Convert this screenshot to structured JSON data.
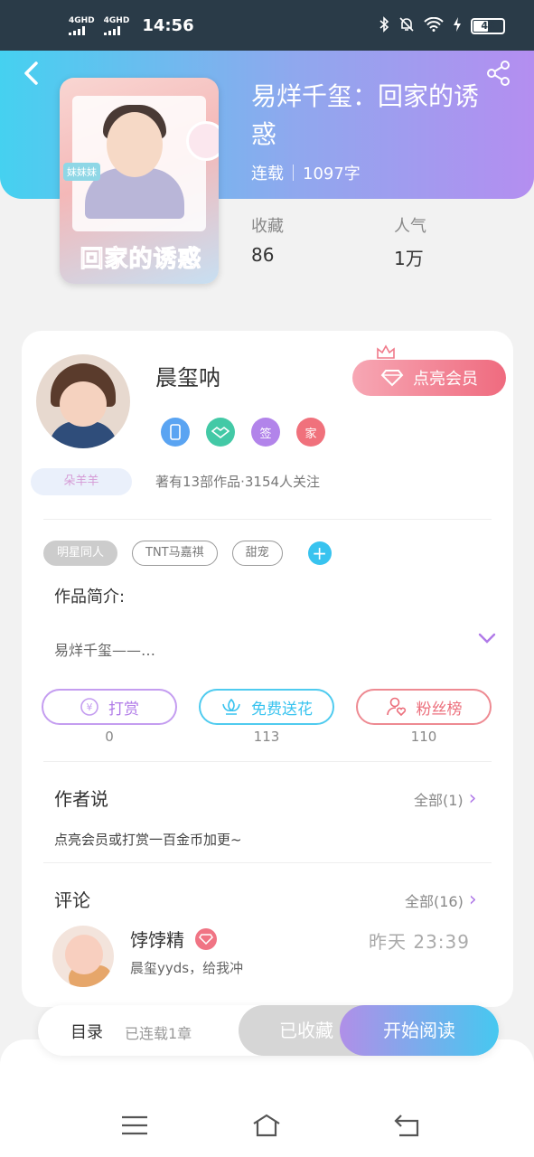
{
  "status_bar": {
    "signal1": "4GHD",
    "signal2": "4GHD",
    "time": "14:56",
    "battery": "49"
  },
  "book": {
    "title": "易烊千玺：回家的诱惑",
    "status": "连载",
    "word_count": "1097字",
    "cover_title": "回家的诱惑",
    "cover_tag": "妹妹妹",
    "favorites_label": "收藏",
    "favorites_value": "86",
    "popularity_label": "人气",
    "popularity_value": "1万"
  },
  "author": {
    "name": "晨玺呐",
    "vip_button": "点亮会员",
    "tagline": "朵羊羊",
    "info": "著有13部作品·3154人关注",
    "badges": [
      "",
      "",
      "签",
      "家"
    ]
  },
  "tags": [
    "明星同人",
    "TNT马嘉祺",
    "甜宠"
  ],
  "intro": {
    "label": "作品简介:",
    "text": "易烊千玺——…"
  },
  "actions": [
    {
      "label": "打赏",
      "count": "0"
    },
    {
      "label": "免费送花",
      "count": "113"
    },
    {
      "label": "粉丝榜",
      "count": "110"
    }
  ],
  "author_says": {
    "label": "作者说",
    "more": "全部(1)",
    "text": "点亮会员或打赏一百金币加更~"
  },
  "comments": {
    "label": "评论",
    "more": "全部(16)",
    "items": [
      {
        "user": "饽饽精",
        "time": "昨天 23:39",
        "text": "晨玺yyds，给我冲"
      }
    ]
  },
  "bottom_bar": {
    "toc": "目录",
    "toc_sub": "已连载1章",
    "favorited": "已收藏",
    "start_reading": "开始阅读"
  },
  "colors": {
    "accent_blue": "#38c3ef",
    "accent_purple": "#b07ae8",
    "accent_pink": "#ef6b7f"
  }
}
